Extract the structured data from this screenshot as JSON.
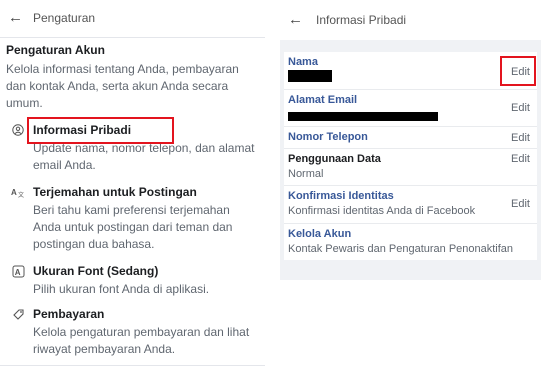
{
  "left": {
    "header": {
      "back_glyph": "←",
      "title": "Pengaturan"
    },
    "section": {
      "title": "Pengaturan Akun",
      "description": "Kelola informasi tentang Anda, pembayaran dan kontak Anda, serta akun Anda secara umum."
    },
    "items": [
      {
        "icon": "person-icon",
        "title": "Informasi Pribadi",
        "description": "Update nama, nomor telepon, dan alamat email Anda."
      },
      {
        "icon": "translate-icon",
        "title": "Terjemahan untuk Postingan",
        "description": "Beri tahu kami preferensi terjemahan Anda untuk postingan dari teman dan postingan dua bahasa."
      },
      {
        "icon": "font-size-icon",
        "title": "Ukuran Font (Sedang)",
        "description": "Pilih ukuran font Anda di aplikasi."
      },
      {
        "icon": "tag-icon",
        "title": "Pembayaran",
        "description": "Kelola pengaturan pembayaran dan lihat riwayat pembayaran Anda."
      }
    ]
  },
  "right": {
    "header": {
      "back_glyph": "←",
      "title": "Informasi Pribadi"
    },
    "rows": [
      {
        "label": "Nama",
        "value": "",
        "action": "Edit"
      },
      {
        "label": "Alamat Email",
        "value": "",
        "action": "Edit"
      },
      {
        "label": "Nomor Telepon",
        "value": "",
        "action": "Edit"
      },
      {
        "label": "Penggunaan Data",
        "value": "Normal",
        "action": "Edit"
      },
      {
        "label": "Konfirmasi Identitas",
        "value": "Konfirmasi identitas Anda di Facebook",
        "action": "Edit"
      },
      {
        "label": "Kelola Akun",
        "value": "Kontak Pewaris dan Pengaturan Penonaktifan",
        "action": ""
      }
    ]
  },
  "colors": {
    "highlight": "#e3141e",
    "link": "#385898",
    "redaction": "#000000"
  }
}
